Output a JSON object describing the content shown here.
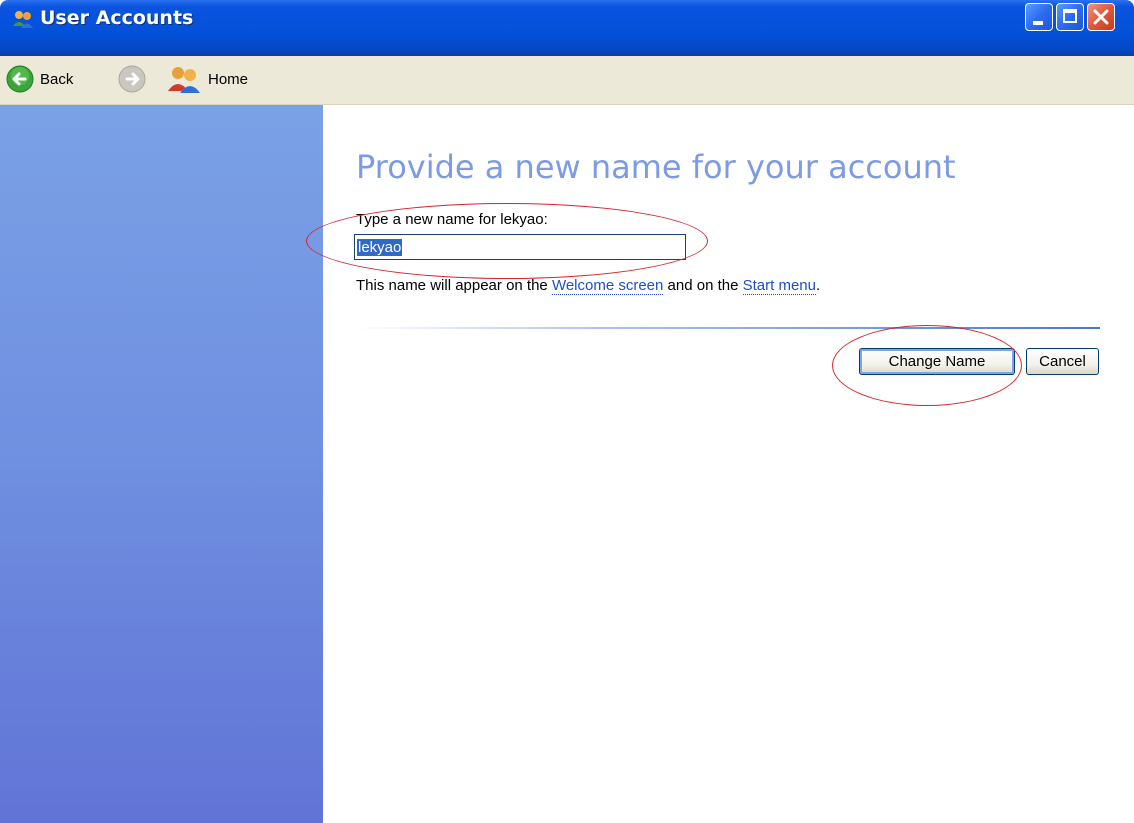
{
  "window": {
    "title": "User Accounts",
    "icon": "users-icon"
  },
  "toolbar": {
    "back_label": "Back",
    "forward_icon": "forward-arrow-icon",
    "home_label": "Home"
  },
  "main": {
    "heading": "Provide a new name for your account",
    "prompt_label": "Type a new name for lekyao:",
    "name_input_value": "lekyao",
    "info_prefix": "This name will appear on the ",
    "info_link_welcome": "Welcome screen",
    "info_middle": " and on the ",
    "info_link_start": "Start menu",
    "info_suffix": ".",
    "change_button_label": "Change Name",
    "cancel_button_label": "Cancel"
  },
  "colors": {
    "title_bar": "#0451d8",
    "left_pane_top": "#7aa1e6",
    "left_pane_bottom": "#6174d6",
    "heading": "#7d9be4",
    "link": "#1f4fc4",
    "annotation": "#d4262c"
  }
}
